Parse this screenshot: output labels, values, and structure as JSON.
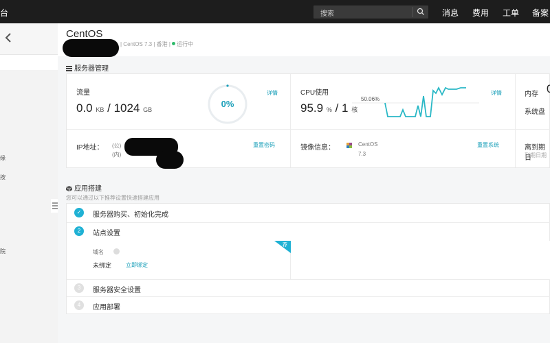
{
  "topbar": {
    "brand_fragment": "台",
    "search_placeholder": "搜索",
    "nav": [
      "消息",
      "费用",
      "工单",
      "备案"
    ]
  },
  "sidebar": {
    "fragments": [
      "缘",
      "按",
      "院"
    ]
  },
  "header": {
    "title": "CentOS",
    "meta": "| CentOS 7.3 | 香港 |",
    "status": "运行中",
    "status_color": "#2fba6b"
  },
  "server_mgmt": {
    "title": "服务器管理",
    "traffic": {
      "label": "流量",
      "used": "0.0",
      "used_unit": "KB",
      "total": "/ 1024",
      "total_unit": "GB",
      "percent": "0%",
      "percent_value": 0,
      "details": "详情"
    },
    "cpu": {
      "label": "CPU使用",
      "value": "95.9",
      "unit": "%",
      "cores": "/ 1",
      "cores_unit": "核",
      "peak_label": "50.06%",
      "details": "详情",
      "chart_color": "#2ab8c6"
    },
    "memory": {
      "label": "内存",
      "value_fragment": "0",
      "disk_label": "系统盘"
    },
    "ip": {
      "label": "IP地址：",
      "public": "(公)",
      "private": "(内)",
      "reset_password": "重置密码"
    },
    "image": {
      "label": "镜像信息：",
      "os": "CentOS",
      "version": "7.3",
      "reset_system": "重置系统"
    },
    "expiry": {
      "label": "离到期日",
      "sub": "到期日期"
    }
  },
  "app_build": {
    "title": "应用搭建",
    "subtitle": "您可以通过以下推荐设置快速搭建应用",
    "steps": [
      {
        "num": "✓",
        "label": "服务器购买、初始化完成",
        "state": "done"
      },
      {
        "num": "2",
        "label": "站点设置",
        "state": "current"
      },
      {
        "num": "3",
        "label": "服务器安全设置",
        "state": "todo"
      },
      {
        "num": "4",
        "label": "应用部署",
        "state": "todo"
      }
    ],
    "site": {
      "domain_label": "域名",
      "unbound": "未绑定",
      "bind_link": "立即绑定",
      "badge": "荐"
    }
  },
  "accent_color": "#1a9fb9"
}
